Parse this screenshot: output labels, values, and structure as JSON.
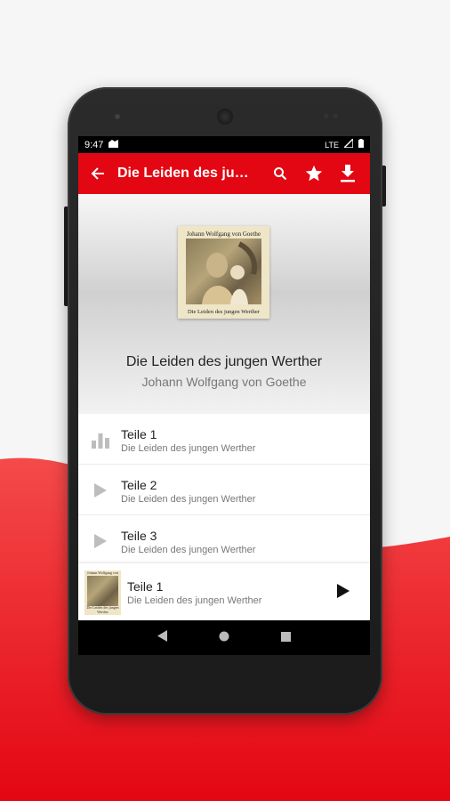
{
  "status": {
    "time": "9:47",
    "network": "LTE"
  },
  "appbar": {
    "title": "Die Leiden des jungen Werther"
  },
  "icons": {
    "back": "arrow-left-icon",
    "search": "search-icon",
    "favorite": "star-icon",
    "download": "download-icon"
  },
  "book": {
    "cover_author": "Johann Wolfgang von Goethe",
    "cover_title": "Die Leiden des jungen Werther",
    "title": "Die Leiden des jungen Werther",
    "author": "Johann Wolfgang von Goethe"
  },
  "chapters": [
    {
      "title": "Teile 1",
      "subtitle": "Die Leiden des jungen Werther",
      "state": "playing"
    },
    {
      "title": "Teile 2",
      "subtitle": "Die Leiden des jungen Werther",
      "state": "idle"
    },
    {
      "title": "Teile 3",
      "subtitle": "Die Leiden des jungen Werther",
      "state": "idle"
    }
  ],
  "player": {
    "title": "Teile 1",
    "subtitle": "Die Leiden des jungen Werther",
    "thumb_author": "Johann Wolfgang von Goethe",
    "thumb_title": "Die Leiden des jungen Werther"
  },
  "colors": {
    "accent": "#e30613",
    "background": "#f6f6f6"
  }
}
